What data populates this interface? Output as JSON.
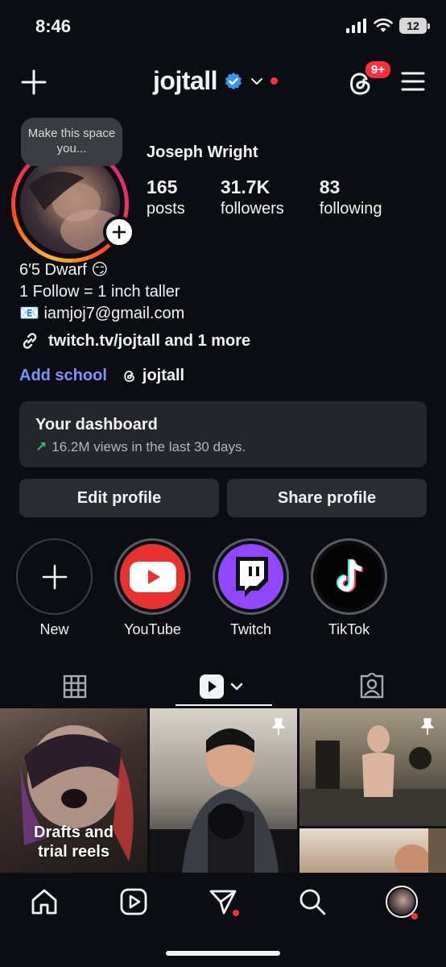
{
  "status_bar": {
    "time": "8:46",
    "battery": "12"
  },
  "header": {
    "username": "jojtall",
    "threads_badge": "9+",
    "icons": [
      "plus-icon",
      "verified-badge-icon",
      "chevron-down-icon",
      "threads-icon",
      "hamburger-menu-icon"
    ]
  },
  "profile": {
    "note": "Make this space you...",
    "full_name": "Joseph Wright",
    "stats": [
      {
        "value": "165",
        "label": "posts"
      },
      {
        "value": "31.7K",
        "label": "followers"
      },
      {
        "value": "83",
        "label": "following"
      }
    ],
    "bio": [
      "6′5 Dwarf 😏",
      "1 Follow = 1 inch taller",
      "📧 iamjoj7@gmail.com"
    ],
    "link": "twitch.tv/jojtall and 1 more",
    "add_school": "Add school",
    "threads_handle": "jojtall"
  },
  "dashboard": {
    "title": "Your dashboard",
    "subtitle": "16.2M views in the last 30 days."
  },
  "buttons": {
    "edit": "Edit profile",
    "share": "Share profile"
  },
  "highlights": [
    {
      "label": "New",
      "color": "#0b0d12"
    },
    {
      "label": "YouTube",
      "color": "#e8322f"
    },
    {
      "label": "Twitch",
      "color": "#9146ff"
    },
    {
      "label": "TikTok",
      "color": "#050505"
    }
  ],
  "grid": {
    "drafts_label_line1": "Drafts and",
    "drafts_label_line2": "trial reels"
  },
  "colors": {
    "accent_link": "#7d93ff",
    "notification": "#ff3040",
    "background": "#0b0d12"
  }
}
